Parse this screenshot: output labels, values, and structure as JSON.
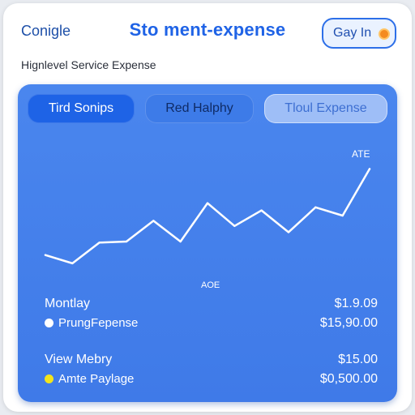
{
  "header": {
    "brand": "Conigle",
    "title": "Sto ment-expense",
    "action_label": "Gay In"
  },
  "subtitle": "Hignlevel Service Expense",
  "tabs": [
    {
      "label": "Tird Sonips",
      "state": "active"
    },
    {
      "label": "Red Halphy",
      "state": "normal"
    },
    {
      "label": "Tloul Expense",
      "state": "muted"
    }
  ],
  "chart_data": {
    "type": "line",
    "annotation_top": "ATE",
    "annotation_bottom": "AOE",
    "series": [
      {
        "values": [
          12,
          4,
          24,
          25,
          45,
          25,
          62,
          40,
          55,
          34,
          58,
          50,
          95
        ]
      }
    ],
    "line_color": "#ffffff"
  },
  "summary": [
    {
      "title": "Montlay",
      "title_value": "$1.9.09",
      "legend_label": "PrungFepense",
      "legend_color": "#ffffff",
      "legend_value": "$15,90.00"
    },
    {
      "title": "View Mebry",
      "title_value": "$15.00",
      "legend_label": "Amte Paylage",
      "legend_color": "#f2e41c",
      "legend_value": "$0,500.00"
    }
  ],
  "colors": {
    "accent": "#1f63e6",
    "panel": "#4a86ee"
  }
}
